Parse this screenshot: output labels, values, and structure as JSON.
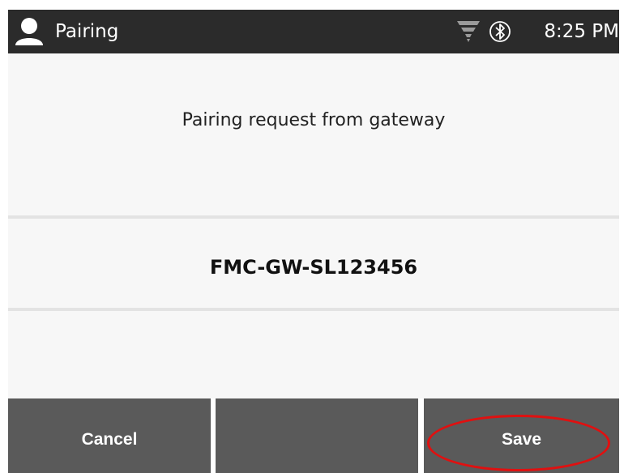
{
  "status_bar": {
    "title": "Pairing",
    "time": "8:25 PM",
    "icons": [
      "user-icon",
      "wifi-icon",
      "bluetooth-icon"
    ]
  },
  "content": {
    "message": "Pairing request from gateway",
    "gateway_id": "FMC-GW-SL123456"
  },
  "buttons": {
    "cancel_label": "Cancel",
    "middle_label": "",
    "save_label": "Save"
  },
  "colors": {
    "status_bar_bg": "#2b2b2b",
    "button_bg": "#5a5a5a",
    "highlight": "#e01010"
  }
}
